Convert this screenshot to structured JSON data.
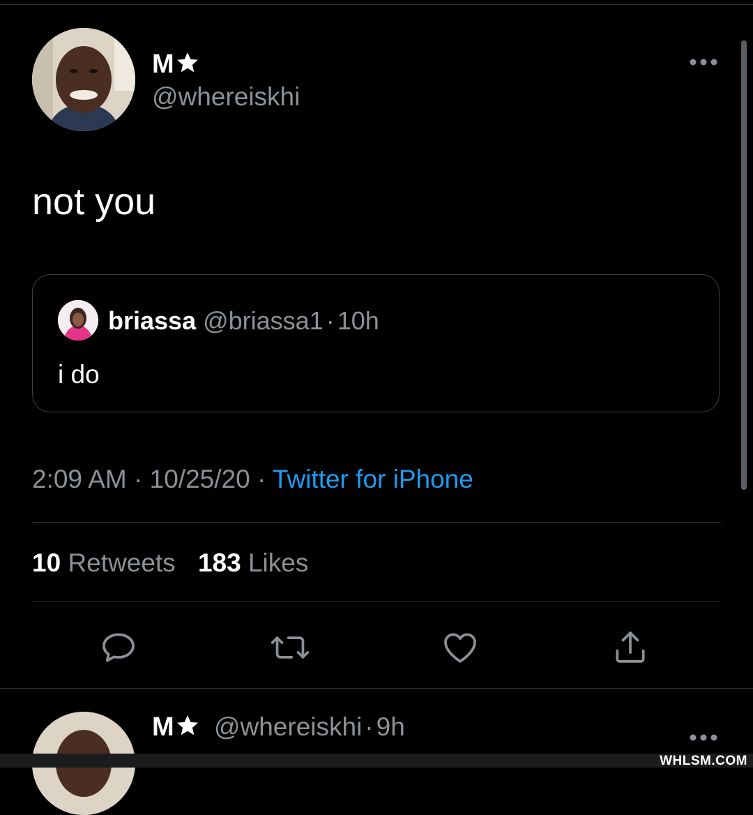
{
  "tweet": {
    "display_name": "M",
    "name_badge_icon": "star-icon",
    "handle": "@whereiskhi",
    "text": "not you",
    "more_icon": "more-horizontal-icon"
  },
  "quoted_tweet": {
    "display_name": "briassa",
    "handle": "@briassa1",
    "separator": "·",
    "time": "10h",
    "text": "i do"
  },
  "meta": {
    "time": "2:09 AM",
    "separator": "·",
    "date": "10/25/20",
    "source": "Twitter for iPhone",
    "source_color": "#1d9bf0"
  },
  "stats": {
    "retweets_count": "10",
    "retweets_label": "Retweets",
    "likes_count": "183",
    "likes_label": "Likes"
  },
  "actions": [
    {
      "name": "reply",
      "icon": "reply-icon"
    },
    {
      "name": "retweet",
      "icon": "retweet-icon"
    },
    {
      "name": "like",
      "icon": "heart-icon"
    },
    {
      "name": "share",
      "icon": "share-icon"
    }
  ],
  "reply_preview": {
    "display_name": "M",
    "handle": "@whereiskhi",
    "separator": "·",
    "time": "9h"
  },
  "watermark": "WHLSM.COM",
  "colors": {
    "background": "#000000",
    "secondary_text": "#8b9196",
    "divider": "#2f3336",
    "accent": "#1d9bf0"
  }
}
